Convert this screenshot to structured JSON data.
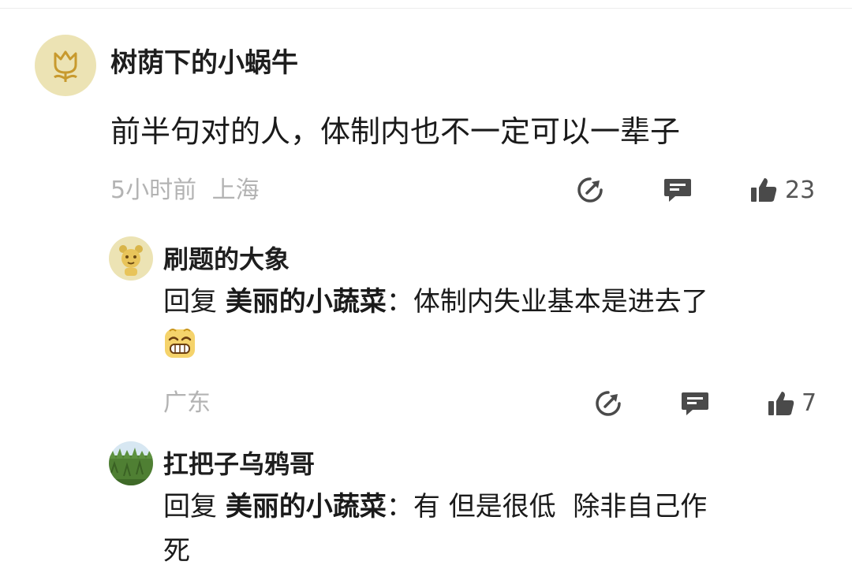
{
  "comment": {
    "username": "树荫下的小蜗牛",
    "avatar": "tulip-avatar",
    "text": "前半句对的人，体制内也不一定可以一辈子",
    "time": "5小时前",
    "location": "上海",
    "likes": "23"
  },
  "replies": [
    {
      "username": "刷题的大象",
      "avatar": "bear-avatar",
      "reply_prefix": "回复",
      "reply_to": "美丽的小蔬菜",
      "separator": "：",
      "text": "体制内失业基本是进去了",
      "emoji": "grin-emoji",
      "location": "广东",
      "likes": "7"
    },
    {
      "username": "扛把子乌鸦哥",
      "avatar": "grass-photo-avatar",
      "reply_prefix": "回复",
      "reply_to": "美丽的小蔬菜",
      "separator": "：",
      "text_line1": "有 但是很低  除非自己作",
      "text_line2": "死"
    }
  ],
  "colors": {
    "text": "#1a1a1a",
    "meta": "#b3b3b3",
    "icon": "#4a4a4a",
    "avatar_bg": "#ece3b4"
  }
}
